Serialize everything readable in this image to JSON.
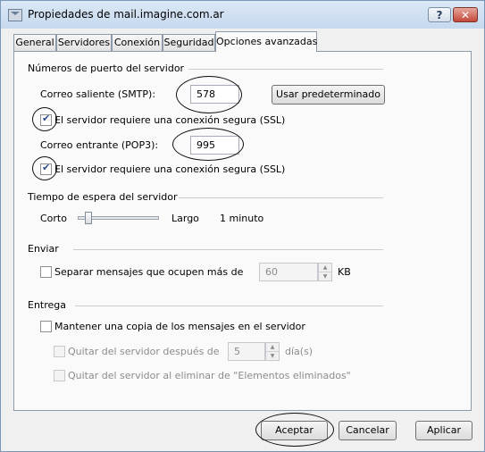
{
  "window": {
    "title": "Propiedades de mail.imagine.com.ar",
    "help_label": "?",
    "close_label": "✕"
  },
  "tabs": [
    {
      "label": "General"
    },
    {
      "label": "Servidores"
    },
    {
      "label": "Conexión"
    },
    {
      "label": "Seguridad"
    },
    {
      "label": "Opciones avanzadas",
      "active": true
    }
  ],
  "ports": {
    "group_label": "Números de puerto del servidor",
    "smtp_label": "Correo saliente (SMTP):",
    "smtp_value": "578",
    "default_button": "Usar predeterminado",
    "smtp_ssl_label": "El servidor requiere una conexión segura (SSL)",
    "smtp_ssl_checked": true,
    "pop3_label": "Correo entrante (POP3):",
    "pop3_value": "995",
    "pop3_ssl_label": "El servidor requiere una conexión segura (SSL)",
    "pop3_ssl_checked": true
  },
  "timeout": {
    "group_label": "Tiempo de espera del servidor",
    "short_label": "Corto",
    "long_label": "Largo",
    "value_label": "1 minuto",
    "level": 0.1
  },
  "send": {
    "group_label": "Enviar",
    "split_label": "Separar mensajes que ocupen más de",
    "split_checked": false,
    "split_value": "60",
    "unit": "KB"
  },
  "delivery": {
    "group_label": "Entrega",
    "keep_copy_label": "Mantener una copia de los mensajes en el servidor",
    "keep_copy_checked": false,
    "remove_after_label": "Quitar del servidor después de",
    "remove_after_value": "5",
    "days_unit": "día(s)",
    "remove_deleted_label": "Quitar del servidor al eliminar de \"Elementos eliminados\""
  },
  "footer": {
    "ok": "Aceptar",
    "cancel": "Cancelar",
    "apply": "Aplicar"
  }
}
